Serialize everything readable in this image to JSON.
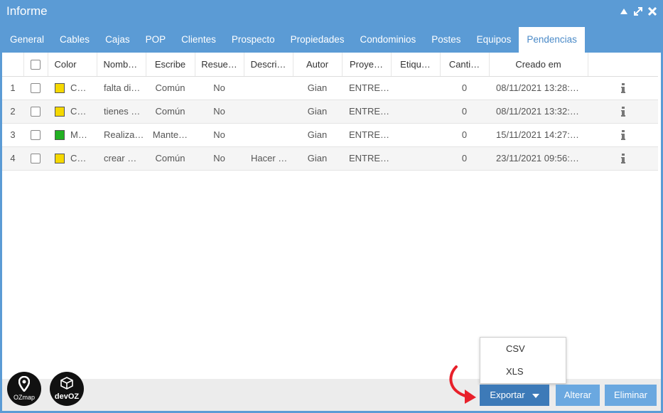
{
  "window": {
    "title": "Informe"
  },
  "tabs": [
    "General",
    "Cables",
    "Cajas",
    "POP",
    "Clientes",
    "Prospecto",
    "Propiedades",
    "Condominios",
    "Postes",
    "Equipos",
    "Pendencias"
  ],
  "active_tab": "Pendencias",
  "table": {
    "headers": {
      "color": "Color",
      "nombre": "Nomb…",
      "escribe": "Escribe",
      "resuelto": "Resue…",
      "descripcion": "Descri…",
      "autor": "Autor",
      "proyecto": "Proye…",
      "etiqueta": "Etiqu…",
      "cantidad": "Canti…",
      "creado": "Creado em"
    },
    "rows": [
      {
        "num": "1",
        "color": "#f5d800",
        "color_label": "C…",
        "nombre": "falta di…",
        "escribe": "Común",
        "resuelto": "No",
        "descripcion": "",
        "autor": "Gian",
        "proyecto": "ENTRE…",
        "etiqueta": "",
        "cantidad": "0",
        "creado": "08/11/2021 13:28:…"
      },
      {
        "num": "2",
        "color": "#f5d800",
        "color_label": "C…",
        "nombre": "tienes …",
        "escribe": "Común",
        "resuelto": "No",
        "descripcion": "",
        "autor": "Gian",
        "proyecto": "ENTRE…",
        "etiqueta": "",
        "cantidad": "0",
        "creado": "08/11/2021 13:32:…"
      },
      {
        "num": "3",
        "color": "#22b022",
        "color_label": "M…",
        "nombre": "Realiza…",
        "escribe": "Mante…",
        "resuelto": "No",
        "descripcion": "",
        "autor": "Gian",
        "proyecto": "ENTRE…",
        "etiqueta": "",
        "cantidad": "0",
        "creado": "15/11/2021 14:27:…"
      },
      {
        "num": "4",
        "color": "#f5d800",
        "color_label": "C…",
        "nombre": "crear …",
        "escribe": "Común",
        "resuelto": "No",
        "descripcion": "Hacer …",
        "autor": "Gian",
        "proyecto": "ENTRE…",
        "etiqueta": "",
        "cantidad": "0",
        "creado": "23/11/2021 09:56:…"
      }
    ]
  },
  "export_menu": {
    "items": [
      "CSV",
      "XLS"
    ]
  },
  "buttons": {
    "export": "Exportar",
    "alter": "Alterar",
    "delete": "Eliminar"
  },
  "logos": {
    "ozmap": "OZmap",
    "devoz": "devOZ"
  },
  "icons": {
    "minimize": "triangle-up-icon",
    "maximize": "expand-icon",
    "close": "close-icon",
    "row_info": "info-icon",
    "export_caret": "caret-down-icon",
    "annotation": "red-arrow-icon"
  },
  "colors": {
    "accent": "#5b9bd5",
    "export_button": "#3d7ab8",
    "secondary_button": "#6aa8e0",
    "annotation_arrow": "#e8202a"
  }
}
